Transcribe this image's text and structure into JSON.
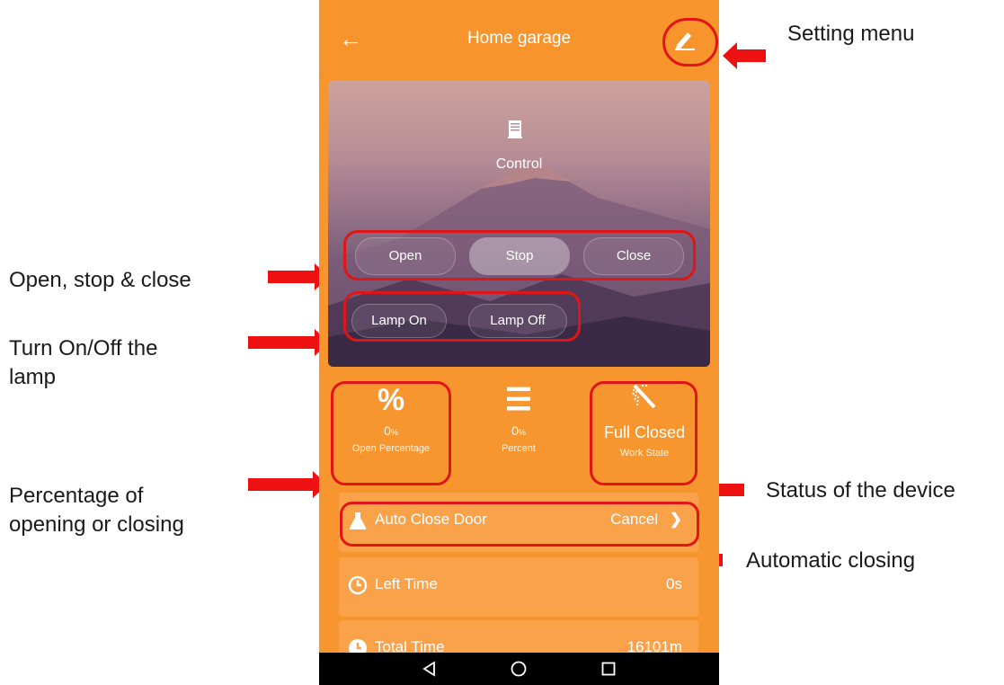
{
  "app": {
    "title": "Home garage",
    "control_label": "Control",
    "buttons": {
      "open": "Open",
      "stop": "Stop",
      "close": "Close",
      "lamp_on": "Lamp On",
      "lamp_off": "Lamp Off"
    },
    "stats": [
      {
        "icon": "percent-icon",
        "value": "0",
        "unit": "%",
        "label": "Open Percentage"
      },
      {
        "icon": "menu-lines-icon",
        "value": "0",
        "unit": "%",
        "label": "Percent"
      },
      {
        "icon": "door-state-icon",
        "value": "Full Closed",
        "label": "Work State"
      }
    ],
    "rows": [
      {
        "icon": "flask-icon",
        "label": "Auto Close Door",
        "value": "Cancel"
      },
      {
        "icon": "clock-icon",
        "label": "Left Time",
        "value": "0s"
      },
      {
        "icon": "clock-icon",
        "label": "Total Time",
        "value": "16101m"
      }
    ],
    "colors": {
      "accent": "#f7962e",
      "highlight": "#e01515"
    }
  },
  "annotations": {
    "setting_menu": "Setting menu",
    "open_stop_close": "Open, stop & close",
    "lamp_line1": "Turn On/Off the",
    "lamp_line2": "lamp",
    "percentage_line1": "Percentage of",
    "percentage_line2": "opening or closing",
    "status": "Status of the device",
    "auto_closing": "Automatic closing"
  }
}
